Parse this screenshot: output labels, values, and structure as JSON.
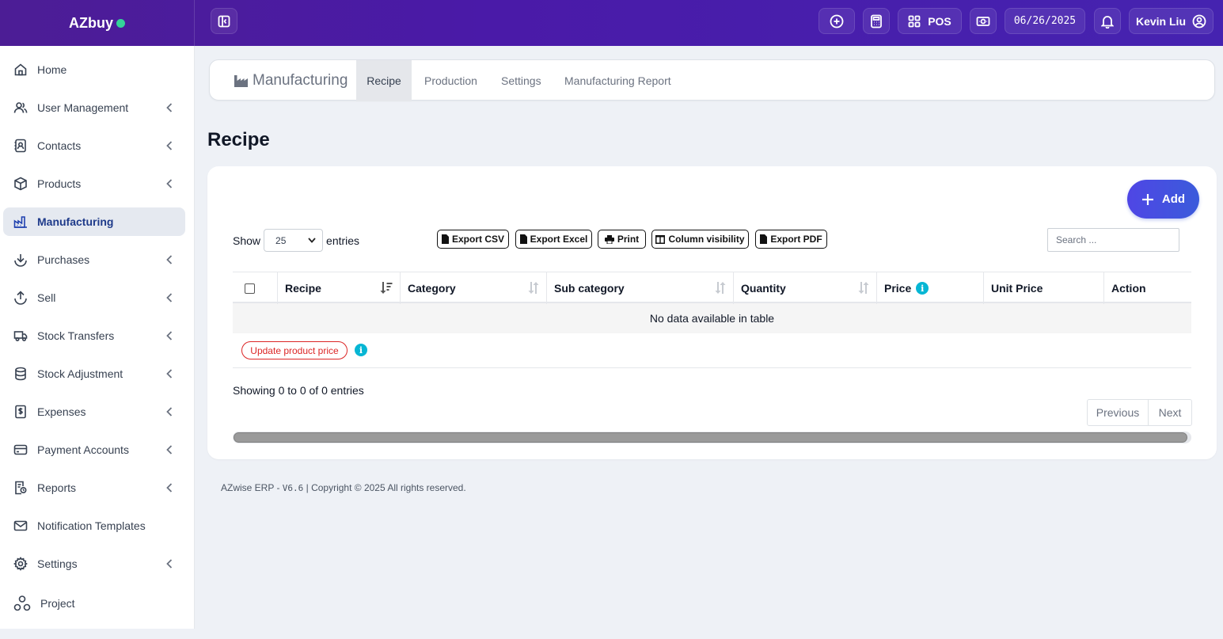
{
  "brand": {
    "name": "AZbuy"
  },
  "topbar": {
    "pos_label": "POS",
    "date": "06/26/2025",
    "user": "Kevin Liu"
  },
  "sidebar": {
    "items": [
      {
        "label": "Home",
        "icon": "home-icon"
      },
      {
        "label": "User Management",
        "icon": "users-icon"
      },
      {
        "label": "Contacts",
        "icon": "contacts-icon"
      },
      {
        "label": "Products",
        "icon": "box-icon"
      },
      {
        "label": "Manufacturing",
        "icon": "factory-icon"
      },
      {
        "label": "Purchases",
        "icon": "download-icon"
      },
      {
        "label": "Sell",
        "icon": "upload-icon"
      },
      {
        "label": "Stock Transfers",
        "icon": "truck-icon"
      },
      {
        "label": "Stock Adjustment",
        "icon": "database-icon"
      },
      {
        "label": "Expenses",
        "icon": "receipt-icon"
      },
      {
        "label": "Payment Accounts",
        "icon": "credit-card-icon"
      },
      {
        "label": "Reports",
        "icon": "report-icon"
      },
      {
        "label": "Notification Templates",
        "icon": "envelope-icon"
      },
      {
        "label": "Settings",
        "icon": "gear-icon"
      },
      {
        "label": "Project",
        "icon": "project-icon"
      }
    ]
  },
  "subnav": {
    "module": "Manufacturing",
    "tabs": [
      "Recipe",
      "Production",
      "Settings",
      "Manufacturing Report"
    ]
  },
  "page": {
    "title": "Recipe"
  },
  "card": {
    "add_label": "Add",
    "show_label": "Show",
    "entries_label": "entries",
    "page_length": "25",
    "export": [
      "Export CSV",
      "Export Excel",
      "Print",
      "Column visibility",
      "Export PDF"
    ],
    "search_placeholder": "Search ...",
    "columns": [
      "Recipe",
      "Category",
      "Sub category",
      "Quantity",
      "Price",
      "Unit Price",
      "Action"
    ],
    "empty_text": "No data available in table",
    "update_price_label": "Update product price",
    "info_glyph": "i",
    "showing_text": "Showing 0 to 0 of 0 entries",
    "prev_label": "Previous",
    "next_label": "Next"
  },
  "footer": {
    "app": "AZwise ERP - ",
    "version": "V6.6",
    "copyright": " | Copyright © 2025 All rights reserved."
  },
  "colors": {
    "topbar": "#4a1aa8",
    "accent": "#4f46e5",
    "online_dot": "#34d399",
    "info": "#06b6d4",
    "danger": "#dc2626"
  }
}
